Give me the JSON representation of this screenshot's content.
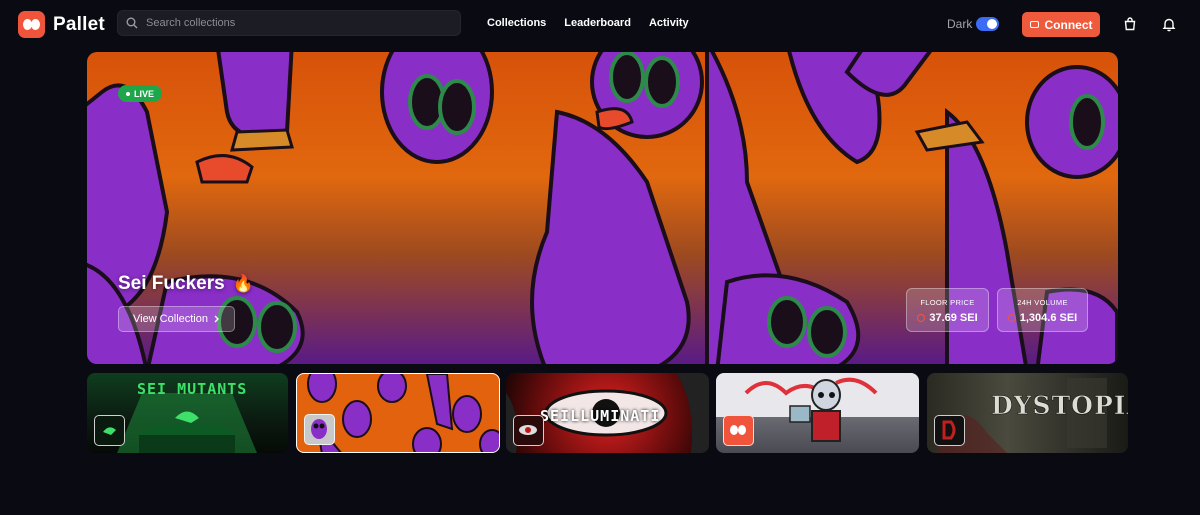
{
  "brand": {
    "name": "Pallet",
    "color": "#f0553c"
  },
  "search": {
    "placeholder": "Search collections",
    "value": ""
  },
  "nav": {
    "links": [
      "Collections",
      "Leaderboard",
      "Activity"
    ]
  },
  "theme": {
    "label": "Dark",
    "enabled": true
  },
  "connect": {
    "label": "Connect"
  },
  "hero": {
    "badge": "LIVE",
    "title": "Sei Fuckers",
    "emoji": "🔥",
    "cta": "View Collection",
    "stats": [
      {
        "label": "FLOOR PRICE",
        "value": "37.69 SEI"
      },
      {
        "label": "24H VOLUME",
        "value": "1,304.6 SEI"
      }
    ]
  },
  "cards": [
    {
      "name": "sei-mutants",
      "title": "SEI MUTANTS"
    },
    {
      "name": "sei-fuckers",
      "title": ""
    },
    {
      "name": "seilluminati",
      "title": "SEILLUMINATI"
    },
    {
      "name": "sei-bot",
      "title": ""
    },
    {
      "name": "dystopia",
      "title": "DYSTOPIA"
    }
  ]
}
